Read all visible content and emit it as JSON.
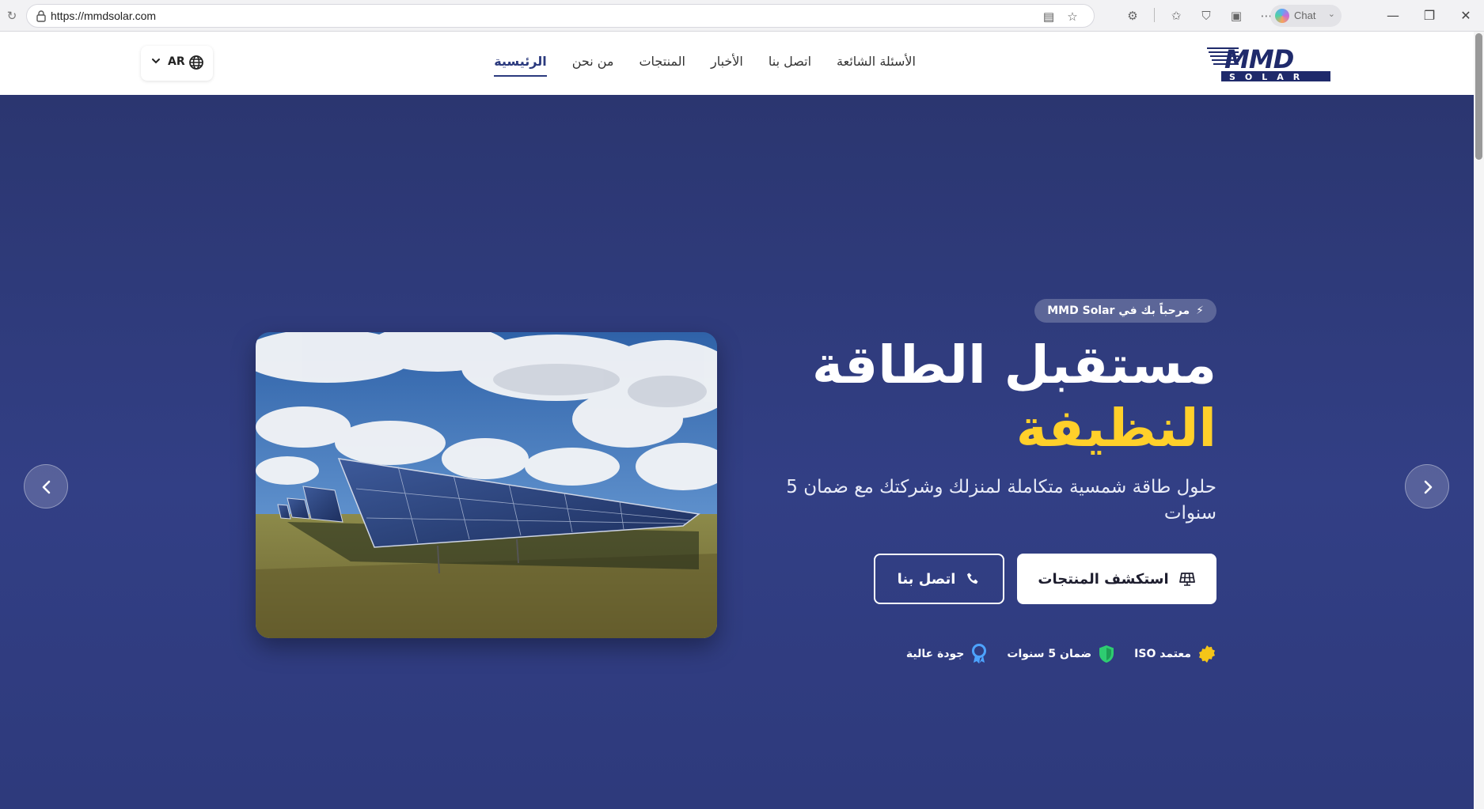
{
  "browser": {
    "url": "https://mmdsolar.com",
    "chat_label": "Chat"
  },
  "header": {
    "logo_alt": "MMD SOLAR",
    "nav": [
      {
        "label": "الرئيسية",
        "active": true
      },
      {
        "label": "من نحن"
      },
      {
        "label": "المنتجات"
      },
      {
        "label": "الأخبار"
      },
      {
        "label": "اتصل بنا"
      },
      {
        "label": "الأسئلة الشائعة"
      }
    ],
    "language": "AR"
  },
  "hero": {
    "welcome": "مرحباً بك في MMD Solar",
    "title_line1": "مستقبل الطاقة",
    "title_line2": "النظيفة",
    "subtitle": "حلول طاقة شمسية متكاملة لمنزلك وشركتك مع ضمان 5 سنوات",
    "primary_button": "استكشف المنتجات",
    "secondary_button": "اتصل بنا",
    "badges": [
      {
        "label": "معتمد ISO",
        "icon": "certificate-icon",
        "color": "#f5c518"
      },
      {
        "label": "ضمان 5 سنوات",
        "icon": "shield-icon",
        "color": "#2ecc71"
      },
      {
        "label": "جودة عالية",
        "icon": "award-icon",
        "color": "#4da3ff"
      }
    ]
  },
  "colors": {
    "brand": "#2b3a7e",
    "accent": "#ffd02a",
    "hero_bg": "#323f85"
  }
}
